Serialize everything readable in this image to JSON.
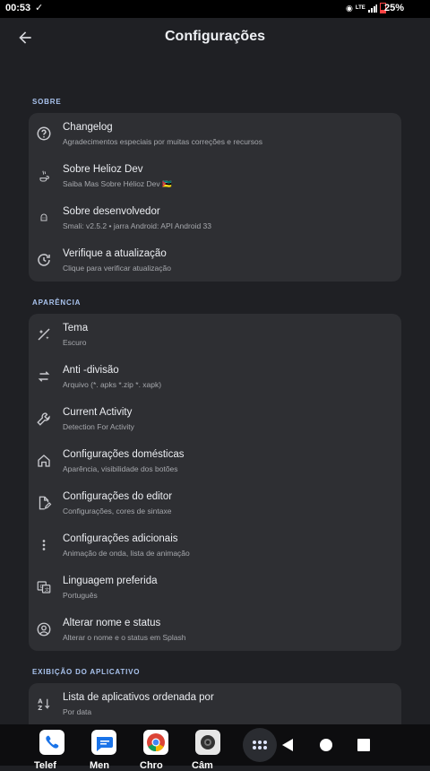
{
  "status_bar": {
    "time": "00:53",
    "battery": "25%",
    "network": "LTE"
  },
  "app_bar": {
    "title": "Configurações"
  },
  "sections": [
    {
      "label": "SOBRE",
      "items": [
        {
          "title": "Changelog",
          "subtitle": "Agradecimentos especiais por muitas correções e recursos",
          "icon": "help-circle-icon"
        },
        {
          "title": "Sobre Helioz Dev",
          "subtitle": "Saiba Mas Sobre Hélioz Dev 🇲🇿",
          "icon": "java-cup-icon"
        },
        {
          "title": "Sobre desenvolvedor",
          "subtitle": "Smali: v2.5.2 • jarra Android: API Android 33",
          "icon": "android-icon"
        },
        {
          "title": "Verifique a atualização",
          "subtitle": "Clique para verificar atualização",
          "icon": "update-icon"
        }
      ]
    },
    {
      "label": "APARÊNCIA",
      "items": [
        {
          "title": "Tema",
          "subtitle": "Escuro",
          "icon": "theme-icon"
        },
        {
          "title": "Anti -divisão",
          "subtitle": "Arquivo (*. apks *.zip *. xapk)",
          "icon": "swap-icon"
        },
        {
          "title": "Current Activity",
          "subtitle": "Detection For Activity",
          "icon": "wrench-icon"
        },
        {
          "title": "Configurações domésticas",
          "subtitle": "Aparência, visibilidade dos botões",
          "icon": "home-icon"
        },
        {
          "title": "Configurações do editor",
          "subtitle": "Configurações, cores de sintaxe",
          "icon": "edit-document-icon"
        },
        {
          "title": "Configurações adicionais",
          "subtitle": "Animação de onda, lista de animação",
          "icon": "more-vert-icon"
        },
        {
          "title": "Linguagem preferida",
          "subtitle": "Português",
          "icon": "translate-icon"
        },
        {
          "title": "Alterar nome e status",
          "subtitle": "Alterar o nome e o status em Splash",
          "icon": "account-circle-icon"
        }
      ]
    },
    {
      "label": "EXIBIÇÃO DO APLICATIVO",
      "items": [
        {
          "title": "Lista de aplicativos ordenada por",
          "subtitle": "Por data",
          "icon": "sort-az-icon"
        }
      ]
    }
  ],
  "dock": {
    "apps": [
      {
        "label": "Telef",
        "icon": "phone-icon"
      },
      {
        "label": "Men",
        "icon": "messages-icon"
      },
      {
        "label": "Chro",
        "icon": "chrome-icon"
      },
      {
        "label": "Câm",
        "icon": "camera-icon"
      }
    ]
  },
  "colors": {
    "background": "#1f2024",
    "card": "#2e2f33",
    "accent": "#a9c3ee"
  }
}
